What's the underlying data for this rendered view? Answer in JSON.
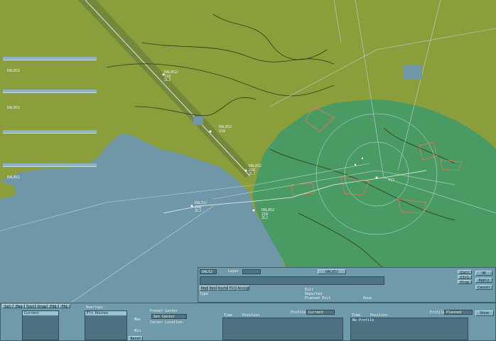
{
  "flight_lists": [
    {
      "rows": [
        {
          "cs": "",
          "sq": "",
          "alt": ""
        },
        {
          "cs": "",
          "sq": "",
          "alt": ""
        },
        {
          "cs": "DAL852",
          "sq": "",
          "alt": ""
        },
        {
          "cs": "",
          "sq": "",
          "alt": ""
        }
      ]
    },
    {
      "rows": [
        {
          "cs": "",
          "sq": "",
          "alt": ""
        },
        {
          "cs": "",
          "sq": "",
          "alt": ""
        },
        {
          "cs": "",
          "sq": "",
          "alt": ""
        },
        {
          "cs": "DAL852",
          "sq": "",
          "alt": ""
        }
      ]
    },
    {
      "rows": [
        {
          "cs": "",
          "sq": "",
          "alt": ""
        },
        {
          "cs": "",
          "sq": "",
          "alt": ""
        },
        {
          "cs": "",
          "sq": "",
          "alt": ""
        },
        {
          "cs": "",
          "sq": "",
          "alt": ""
        }
      ]
    },
    {
      "rows": [
        {
          "cs": "",
          "sq": "",
          "alt": ""
        },
        {
          "cs": "",
          "sq": "",
          "alt": ""
        },
        {
          "cs": "DAL852",
          "sq": "",
          "alt": ""
        }
      ]
    }
  ],
  "track_tags": [
    {
      "id": "t1",
      "text": "DAL852/\n218\n2LJ"
    },
    {
      "id": "t2",
      "text": "DAL852\n218"
    },
    {
      "id": "t3",
      "text": "DAL852\n218\n2LJ"
    },
    {
      "id": "t4",
      "text": "DAL52/\n218\n2LJ"
    },
    {
      "id": "t5",
      "text": "DAL852\n218\n2LJ"
    },
    {
      "id": "t6",
      "text": "YVJ"
    }
  ],
  "flight_panel": {
    "callsign": "DAL52",
    "layer_label": "Layer",
    "layer_value": "",
    "cs_btn": "DAL852",
    "type_label": "Type",
    "tabs": [
      "Dep",
      "Des",
      "Route",
      "Flt",
      "Assign"
    ],
    "exit_label": "Exit",
    "beacon_label": "",
    "departed_label": "Departed",
    "planned_exit_label": "Planned Exit",
    "route_text": "",
    "ouve_label": "Ouve"
  },
  "right_controls": {
    "buttons": [
      "Curr",
      "Ctrl",
      "Prop",
      "Cancel",
      "Apply",
      "OK",
      "Done"
    ]
  },
  "toolbar_buttons": [
    "Sel",
    "Map",
    "Tool",
    "Draw",
    "Fdb",
    "FRL"
  ],
  "bottom": {
    "list1_items": [
      "",
      "",
      "Current",
      "",
      "",
      ""
    ],
    "list2_header": "Overlays",
    "list2_items": [
      "",
      "",
      "Flt Routes",
      "",
      "",
      "",
      "",
      "",
      ""
    ],
    "preset_label": "Preset Center",
    "preset_value": "Set Center",
    "center_label": "Center Location:",
    "min_label": "Min",
    "max_label": "Max",
    "reset_label": "Reset",
    "time_label": "Time",
    "position_label": "Position",
    "profile_label": "Profile",
    "profile_value": "Current",
    "profile_value2": "Planned",
    "entry": "No Profile",
    "done_label": "Done",
    "dal_label": "DAL852"
  }
}
